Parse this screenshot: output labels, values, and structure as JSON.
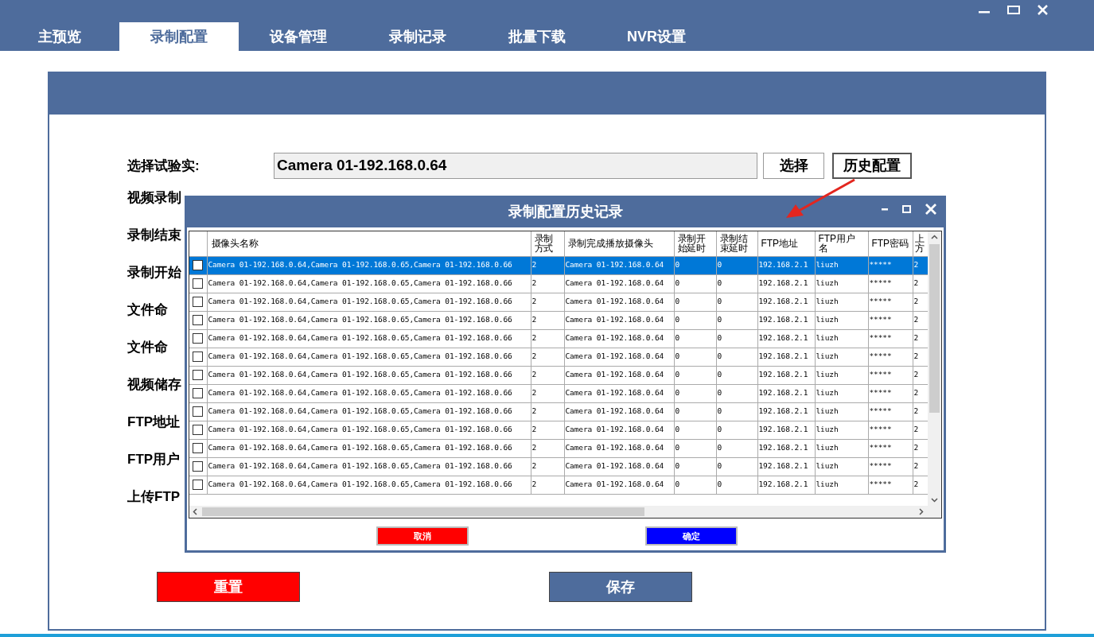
{
  "tabs": [
    {
      "label": "主预览",
      "selected": false
    },
    {
      "label": "录制配置",
      "selected": true
    },
    {
      "label": "设备管理",
      "selected": false
    },
    {
      "label": "录制记录",
      "selected": false
    },
    {
      "label": "批量下载",
      "selected": false
    },
    {
      "label": "NVR设置",
      "selected": false
    }
  ],
  "form": {
    "select_label": "选择试验实:",
    "select_value": "Camera 01-192.168.0.64",
    "select_button": "选择",
    "history_button": "历史配置",
    "field_labels": [
      "视频录制",
      "录制结束",
      "录制开始",
      "文件命",
      "文件命",
      "视频储存",
      "FTP地址",
      "FTP用户",
      "上传FTP"
    ]
  },
  "actions": [
    {
      "label": "重置",
      "kind": "reset"
    },
    {
      "label": "保存",
      "kind": "save"
    }
  ],
  "dialog": {
    "title": "录制配置历史记录",
    "columns": [
      "摄像头名称",
      "录制方式",
      "录制完成播放摄像头",
      "录制开始延时",
      "录制结束延时",
      "FTP地址",
      "FTP用户名",
      "FTP密码",
      "上方"
    ],
    "rows": [
      {
        "selected": true,
        "checked": false,
        "cells": [
          "Camera 01-192.168.0.64,Camera 01-192.168.0.65,Camera 01-192.168.0.66",
          "2",
          "Camera 01-192.168.0.64",
          "0",
          "0",
          "192.168.2.1",
          "liuzh",
          "*****",
          "2"
        ]
      },
      {
        "selected": false,
        "checked": false,
        "cells": [
          "Camera 01-192.168.0.64,Camera 01-192.168.0.65,Camera 01-192.168.0.66",
          "2",
          "Camera 01-192.168.0.64",
          "0",
          "0",
          "192.168.2.1",
          "liuzh",
          "*****",
          "2"
        ]
      },
      {
        "selected": false,
        "checked": false,
        "cells": [
          "Camera 01-192.168.0.64,Camera 01-192.168.0.65,Camera 01-192.168.0.66",
          "2",
          "Camera 01-192.168.0.64",
          "0",
          "0",
          "192.168.2.1",
          "liuzh",
          "*****",
          "2"
        ]
      },
      {
        "selected": false,
        "checked": false,
        "cells": [
          "Camera 01-192.168.0.64,Camera 01-192.168.0.65,Camera 01-192.168.0.66",
          "2",
          "Camera 01-192.168.0.64",
          "0",
          "0",
          "192.168.2.1",
          "liuzh",
          "*****",
          "2"
        ]
      },
      {
        "selected": false,
        "checked": false,
        "cells": [
          "Camera 01-192.168.0.64,Camera 01-192.168.0.65,Camera 01-192.168.0.66",
          "2",
          "Camera 01-192.168.0.64",
          "0",
          "0",
          "192.168.2.1",
          "liuzh",
          "*****",
          "2"
        ]
      },
      {
        "selected": false,
        "checked": false,
        "cells": [
          "Camera 01-192.168.0.64,Camera 01-192.168.0.65,Camera 01-192.168.0.66",
          "2",
          "Camera 01-192.168.0.64",
          "0",
          "0",
          "192.168.2.1",
          "liuzh",
          "*****",
          "2"
        ]
      },
      {
        "selected": false,
        "checked": false,
        "cells": [
          "Camera 01-192.168.0.64,Camera 01-192.168.0.65,Camera 01-192.168.0.66",
          "2",
          "Camera 01-192.168.0.64",
          "0",
          "0",
          "192.168.2.1",
          "liuzh",
          "*****",
          "2"
        ]
      },
      {
        "selected": false,
        "checked": false,
        "cells": [
          "Camera 01-192.168.0.64,Camera 01-192.168.0.65,Camera 01-192.168.0.66",
          "2",
          "Camera 01-192.168.0.64",
          "0",
          "0",
          "192.168.2.1",
          "liuzh",
          "*****",
          "2"
        ]
      },
      {
        "selected": false,
        "checked": false,
        "cells": [
          "Camera 01-192.168.0.64,Camera 01-192.168.0.65,Camera 01-192.168.0.66",
          "2",
          "Camera 01-192.168.0.64",
          "0",
          "0",
          "192.168.2.1",
          "liuzh",
          "*****",
          "2"
        ]
      },
      {
        "selected": false,
        "checked": false,
        "cells": [
          "Camera 01-192.168.0.64,Camera 01-192.168.0.65,Camera 01-192.168.0.66",
          "2",
          "Camera 01-192.168.0.64",
          "0",
          "0",
          "192.168.2.1",
          "liuzh",
          "*****",
          "2"
        ]
      },
      {
        "selected": false,
        "checked": false,
        "cells": [
          "Camera 01-192.168.0.64,Camera 01-192.168.0.65,Camera 01-192.168.0.66",
          "2",
          "Camera 01-192.168.0.64",
          "0",
          "0",
          "192.168.2.1",
          "liuzh",
          "*****",
          "2"
        ]
      },
      {
        "selected": false,
        "checked": false,
        "cells": [
          "Camera 01-192.168.0.64,Camera 01-192.168.0.65,Camera 01-192.168.0.66",
          "2",
          "Camera 01-192.168.0.64",
          "0",
          "0",
          "192.168.2.1",
          "liuzh",
          "*****",
          "2"
        ]
      },
      {
        "selected": false,
        "checked": false,
        "cells": [
          "Camera 01-192.168.0.64,Camera 01-192.168.0.65,Camera 01-192.168.0.66",
          "2",
          "Camera 01-192.168.0.64",
          "0",
          "0",
          "192.168.2.1",
          "liuzh",
          "*****",
          "2"
        ]
      }
    ],
    "buttons": [
      {
        "label": "取消",
        "kind": "cancel"
      },
      {
        "label": "确定",
        "kind": "ok"
      }
    ]
  }
}
